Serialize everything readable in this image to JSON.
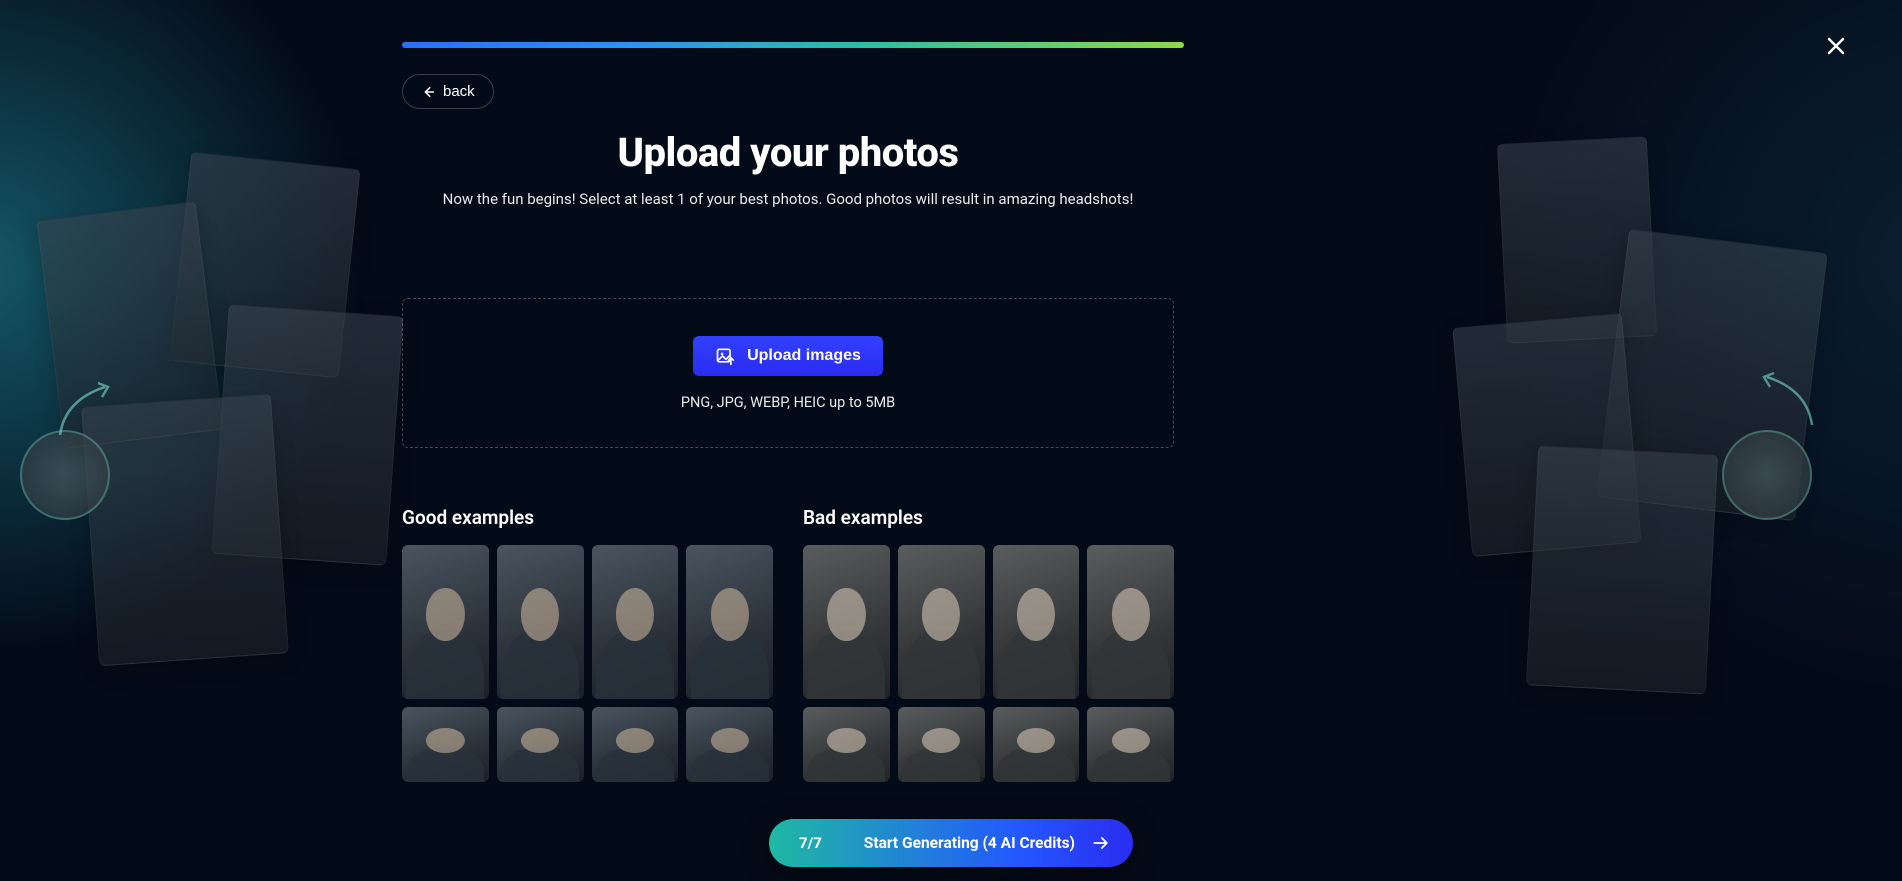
{
  "header": {
    "back_label": "back"
  },
  "page": {
    "title": "Upload your photos",
    "subtitle": "Now the fun begins! Select at least 1 of your best photos. Good photos will result in amazing headshots!"
  },
  "upload": {
    "button_label": "Upload images",
    "hint": "PNG, JPG, WEBP, HEIC up to 5MB"
  },
  "examples": {
    "good_title": "Good examples",
    "bad_title": "Bad examples"
  },
  "footer": {
    "step": "7/7",
    "cta": "Start Generating (4 AI Credits)"
  }
}
